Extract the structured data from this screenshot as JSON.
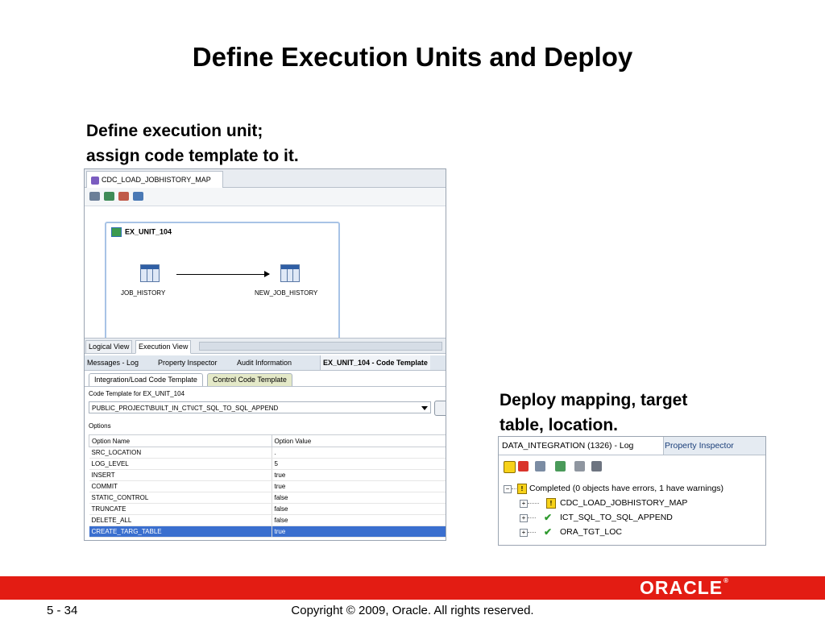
{
  "slide": {
    "title": "Define Execution Units and Deploy",
    "caption_left": [
      "Define execution unit;",
      "assign code template to it."
    ],
    "caption_right": [
      "Deploy mapping, target",
      "table, location."
    ]
  },
  "left_screenshot": {
    "map_tab": "CDC_LOAD_JOBHISTORY_MAP",
    "execution_unit": "EX_UNIT_104",
    "source_table": "JOB_HISTORY",
    "target_table": "NEW_JOB_HISTORY",
    "view_tabs": [
      "Logical View",
      "Execution View"
    ],
    "bottom_tabs": [
      "Messages - Log",
      "Property Inspector",
      "Audit Information",
      "EX_UNIT_104 - Code Template"
    ],
    "code_tabs": [
      "Integration/Load Code Template",
      "Control Code Template"
    ],
    "code_template_label": "Code Template for EX_UNIT_104",
    "code_template_value": "PUBLIC_PROJECT\\BUILT_IN_CT\\ICT_SQL_TO_SQL_APPEND",
    "options_label": "Options",
    "options_headers": [
      "Option Name",
      "Option Value"
    ],
    "options": [
      {
        "name": "SRC_LOCATION",
        "value": "."
      },
      {
        "name": "LOG_LEVEL",
        "value": "5"
      },
      {
        "name": "INSERT",
        "value": "true"
      },
      {
        "name": "COMMIT",
        "value": "true"
      },
      {
        "name": "STATIC_CONTROL",
        "value": "false"
      },
      {
        "name": "TRUNCATE",
        "value": "false"
      },
      {
        "name": "DELETE_ALL",
        "value": "false"
      },
      {
        "name": "CREATE_TARG_TABLE",
        "value": "true"
      }
    ],
    "selected_option": "CREATE_TARG_TABLE"
  },
  "right_screenshot": {
    "tabs": [
      "DATA_INTEGRATION (1326) - Log",
      "Property Inspector"
    ],
    "tree": [
      "Completed (0 objects have errors, 1 have warnings)",
      "CDC_LOAD_JOBHISTORY_MAP",
      "ICT_SQL_TO_SQL_APPEND",
      "ORA_TGT_LOC"
    ]
  },
  "footer": {
    "logo": "ORACLE",
    "page_number": "5 - 34",
    "copyright": "Copyright © 2009, Oracle. All rights reserved."
  },
  "colors": {
    "footer_bar": "#e31c13",
    "selection": "#3a6fcf"
  }
}
